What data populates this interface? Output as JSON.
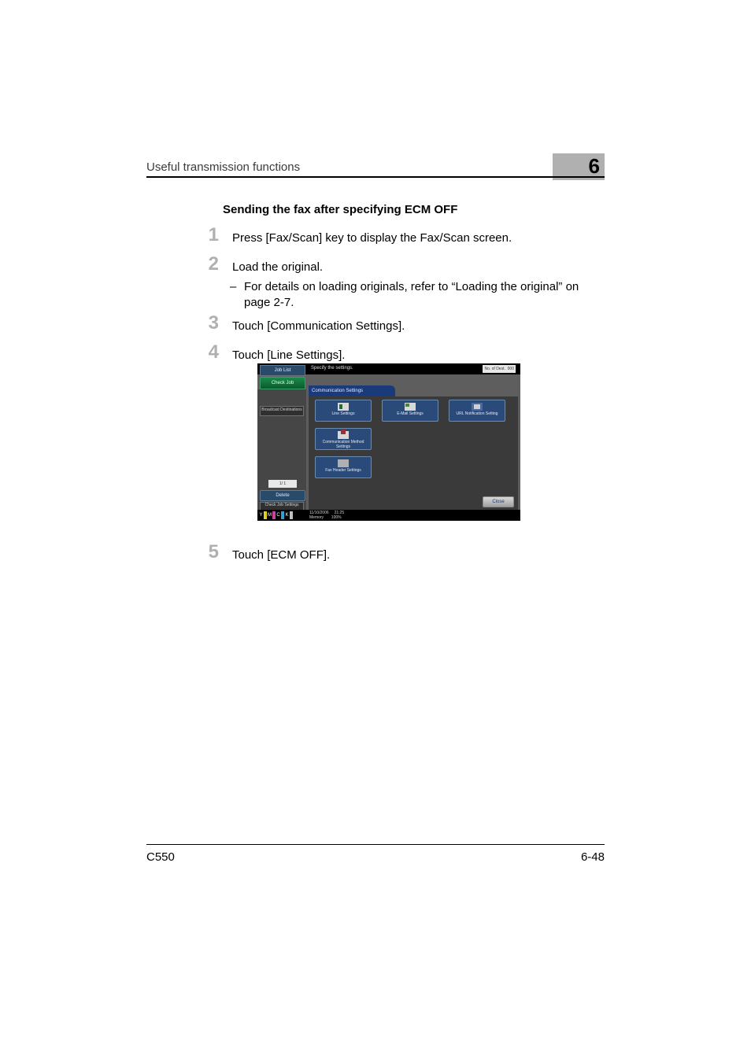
{
  "header": {
    "running_title": "Useful transmission functions",
    "chapter_number": "6"
  },
  "section": {
    "heading": "Sending the fax after specifying ECM OFF"
  },
  "steps": [
    {
      "num": "1",
      "text": "Press [Fax/Scan] key to display the Fax/Scan screen."
    },
    {
      "num": "2",
      "text": "Load the original."
    },
    {
      "num": "3",
      "text": "Touch [Communication Settings]."
    },
    {
      "num": "4",
      "text": "Touch [Line Settings]."
    },
    {
      "num": "5",
      "text": "Touch [ECM OFF]."
    }
  ],
  "substep_2": "For details on loading originals, refer to “Loading the original” on page 2-7.",
  "embedded_screen": {
    "job_list": "Job List",
    "specify": "Specify the settings.",
    "counter": {
      "label": "No. of Dest.",
      "value": "000"
    },
    "check_job": "Check Job",
    "broadcast": "Broadcast Destinations",
    "page_counter": "1/   1",
    "delete": "Delete",
    "check_job_settings": "Check Job Settings",
    "tab_title": "Communication Settings",
    "buttons": {
      "line": "Line Settings",
      "email": "E-Mail Settings",
      "url": "URL Notification Setting",
      "comm": "Communication Method Settings",
      "fax": "Fax Header Settings"
    },
    "close": "Close",
    "status": {
      "date": "11/10/2006",
      "time": "21:25",
      "mem_label": "Memory",
      "mem_value": "100%"
    }
  },
  "footer": {
    "model": "C550",
    "page": "6-48"
  }
}
